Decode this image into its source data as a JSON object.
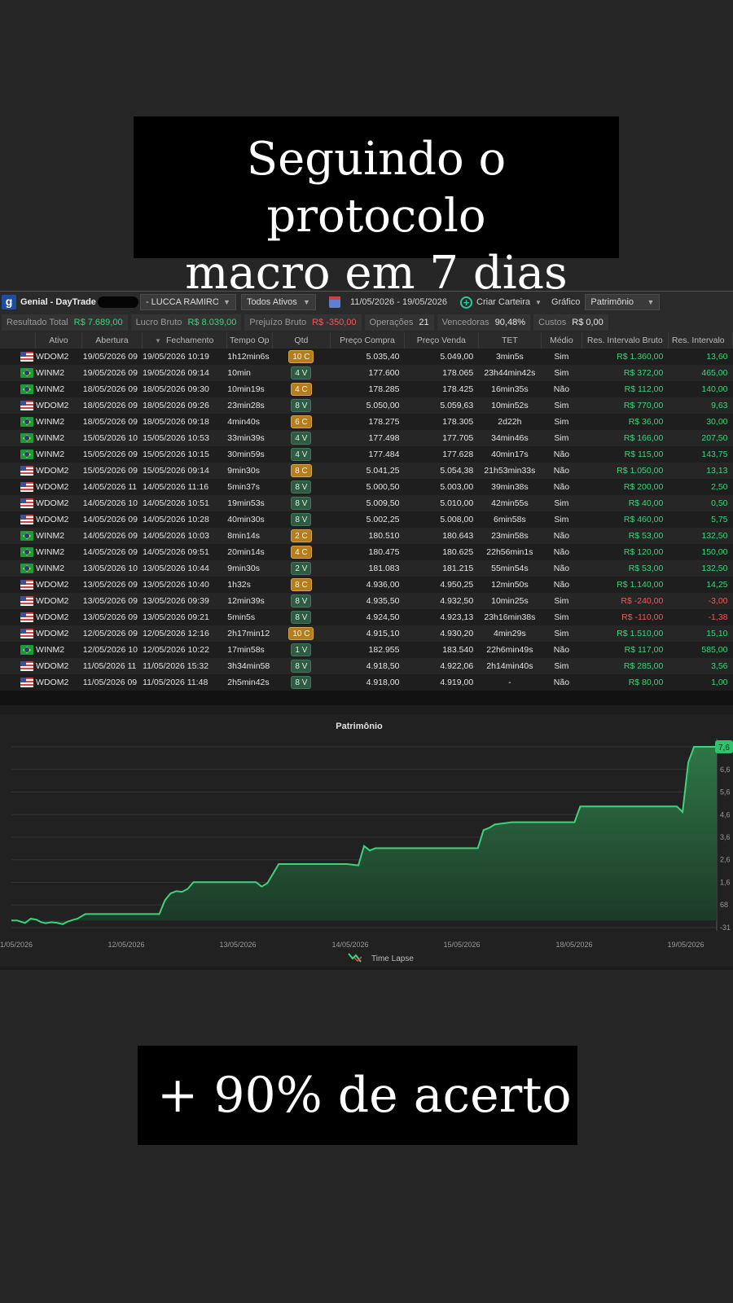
{
  "captions": {
    "top_line1": "Seguindo o protocolo",
    "top_line2": "macro em 7 dias",
    "bottom": "+ 90% de acerto"
  },
  "toolbar": {
    "logo": "g",
    "account_prefix": "Genial - DayTrade",
    "account_name": "- LUCCA RAMIRO DE S",
    "asset_filter": "Todos Ativos",
    "date_range": "11/05/2026 - 19/05/2026",
    "create_wallet": "Criar Carteira",
    "chart_label": "Gráfico",
    "chart_select": "Patrimônio"
  },
  "stats": [
    {
      "label": "Resultado Total",
      "value": "R$ 7.689,00",
      "tone": "pos"
    },
    {
      "label": "Lucro Bruto",
      "value": "R$ 8.039,00",
      "tone": "pos"
    },
    {
      "label": "Prejuízo Bruto",
      "value": "R$ -350,00",
      "tone": "neg"
    },
    {
      "label": "Operações",
      "value": "21",
      "tone": "wht"
    },
    {
      "label": "Vencedoras",
      "value": "90,48%",
      "tone": "wht"
    },
    {
      "label": "Custos",
      "value": "R$ 0,00",
      "tone": "wht"
    }
  ],
  "table": {
    "headers": [
      "Ativo",
      "Abertura",
      "Fechamento",
      "Tempo Op",
      "Qtd",
      "Preço Compra",
      "Preço Venda",
      "TET",
      "Médio",
      "Res. Intervalo Bruto",
      "Res. Intervalo"
    ],
    "rows": [
      {
        "flag": "us",
        "ativo": "WDOM2",
        "abertura": "19/05/2026 09",
        "fechamento": "19/05/2026 10:19",
        "tempo": "1h12min6s",
        "qtd": "10 C",
        "side": "c",
        "compra": "5.035,40",
        "venda": "5.049,00",
        "tet": "3min5s",
        "medio": "Sim",
        "bruto": "R$ 1.360,00",
        "intervalo": "13,60",
        "tone": "pos"
      },
      {
        "flag": "br",
        "ativo": "WINM2",
        "abertura": "19/05/2026 09",
        "fechamento": "19/05/2026 09:14",
        "tempo": "10min",
        "qtd": "4 V",
        "side": "v",
        "compra": "177.600",
        "venda": "178.065",
        "tet": "23h44min42s",
        "medio": "Sim",
        "bruto": "R$ 372,00",
        "intervalo": "465,00",
        "tone": "pos"
      },
      {
        "flag": "br",
        "ativo": "WINM2",
        "abertura": "18/05/2026 09",
        "fechamento": "18/05/2026 09:30",
        "tempo": "10min19s",
        "qtd": "4 C",
        "side": "c",
        "compra": "178.285",
        "venda": "178.425",
        "tet": "16min35s",
        "medio": "Não",
        "bruto": "R$ 112,00",
        "intervalo": "140,00",
        "tone": "pos"
      },
      {
        "flag": "us",
        "ativo": "WDOM2",
        "abertura": "18/05/2026 09",
        "fechamento": "18/05/2026 09:26",
        "tempo": "23min28s",
        "qtd": "8 V",
        "side": "v",
        "compra": "5.050,00",
        "venda": "5.059,63",
        "tet": "10min52s",
        "medio": "Sim",
        "bruto": "R$ 770,00",
        "intervalo": "9,63",
        "tone": "pos"
      },
      {
        "flag": "br",
        "ativo": "WINM2",
        "abertura": "18/05/2026 09",
        "fechamento": "18/05/2026 09:18",
        "tempo": "4min40s",
        "qtd": "6 C",
        "side": "c",
        "compra": "178.275",
        "venda": "178.305",
        "tet": "2d22h",
        "medio": "Sim",
        "bruto": "R$ 36,00",
        "intervalo": "30,00",
        "tone": "pos"
      },
      {
        "flag": "br",
        "ativo": "WINM2",
        "abertura": "15/05/2026 10",
        "fechamento": "15/05/2026 10:53",
        "tempo": "33min39s",
        "qtd": "4 V",
        "side": "v",
        "compra": "177.498",
        "venda": "177.705",
        "tet": "34min46s",
        "medio": "Sim",
        "bruto": "R$ 166,00",
        "intervalo": "207,50",
        "tone": "pos"
      },
      {
        "flag": "br",
        "ativo": "WINM2",
        "abertura": "15/05/2026 09",
        "fechamento": "15/05/2026 10:15",
        "tempo": "30min59s",
        "qtd": "4 V",
        "side": "v",
        "compra": "177.484",
        "venda": "177.628",
        "tet": "40min17s",
        "medio": "Não",
        "bruto": "R$ 115,00",
        "intervalo": "143,75",
        "tone": "pos"
      },
      {
        "flag": "us",
        "ativo": "WDOM2",
        "abertura": "15/05/2026 09",
        "fechamento": "15/05/2026 09:14",
        "tempo": "9min30s",
        "qtd": "8 C",
        "side": "c",
        "compra": "5.041,25",
        "venda": "5.054,38",
        "tet": "21h53min33s",
        "medio": "Não",
        "bruto": "R$ 1.050,00",
        "intervalo": "13,13",
        "tone": "pos"
      },
      {
        "flag": "us",
        "ativo": "WDOM2",
        "abertura": "14/05/2026 11",
        "fechamento": "14/05/2026 11:16",
        "tempo": "5min37s",
        "qtd": "8 V",
        "side": "v",
        "compra": "5.000,50",
        "venda": "5.003,00",
        "tet": "39min38s",
        "medio": "Não",
        "bruto": "R$ 200,00",
        "intervalo": "2,50",
        "tone": "pos"
      },
      {
        "flag": "us",
        "ativo": "WDOM2",
        "abertura": "14/05/2026 10",
        "fechamento": "14/05/2026 10:51",
        "tempo": "19min53s",
        "qtd": "8 V",
        "side": "v",
        "compra": "5.009,50",
        "venda": "5.010,00",
        "tet": "42min55s",
        "medio": "Sim",
        "bruto": "R$ 40,00",
        "intervalo": "0,50",
        "tone": "pos"
      },
      {
        "flag": "us",
        "ativo": "WDOM2",
        "abertura": "14/05/2026 09",
        "fechamento": "14/05/2026 10:28",
        "tempo": "40min30s",
        "qtd": "8 V",
        "side": "v",
        "compra": "5.002,25",
        "venda": "5.008,00",
        "tet": "6min58s",
        "medio": "Sim",
        "bruto": "R$ 460,00",
        "intervalo": "5,75",
        "tone": "pos"
      },
      {
        "flag": "br",
        "ativo": "WINM2",
        "abertura": "14/05/2026 09",
        "fechamento": "14/05/2026 10:03",
        "tempo": "8min14s",
        "qtd": "2 C",
        "side": "c",
        "compra": "180.510",
        "venda": "180.643",
        "tet": "23min58s",
        "medio": "Não",
        "bruto": "R$ 53,00",
        "intervalo": "132,50",
        "tone": "pos"
      },
      {
        "flag": "br",
        "ativo": "WINM2",
        "abertura": "14/05/2026 09",
        "fechamento": "14/05/2026 09:51",
        "tempo": "20min14s",
        "qtd": "4 C",
        "side": "c",
        "compra": "180.475",
        "venda": "180.625",
        "tet": "22h56min1s",
        "medio": "Não",
        "bruto": "R$ 120,00",
        "intervalo": "150,00",
        "tone": "pos"
      },
      {
        "flag": "br",
        "ativo": "WINM2",
        "abertura": "13/05/2026 10",
        "fechamento": "13/05/2026 10:44",
        "tempo": "9min30s",
        "qtd": "2 V",
        "side": "v",
        "compra": "181.083",
        "venda": "181.215",
        "tet": "55min54s",
        "medio": "Não",
        "bruto": "R$ 53,00",
        "intervalo": "132,50",
        "tone": "pos"
      },
      {
        "flag": "us",
        "ativo": "WDOM2",
        "abertura": "13/05/2026 09",
        "fechamento": "13/05/2026 10:40",
        "tempo": "1h32s",
        "qtd": "8 C",
        "side": "c",
        "compra": "4.936,00",
        "venda": "4.950,25",
        "tet": "12min50s",
        "medio": "Não",
        "bruto": "R$ 1.140,00",
        "intervalo": "14,25",
        "tone": "pos"
      },
      {
        "flag": "us",
        "ativo": "WDOM2",
        "abertura": "13/05/2026 09",
        "fechamento": "13/05/2026 09:39",
        "tempo": "12min39s",
        "qtd": "8 V",
        "side": "v",
        "compra": "4.935,50",
        "venda": "4.932,50",
        "tet": "10min25s",
        "medio": "Sim",
        "bruto": "R$ -240,00",
        "intervalo": "-3,00",
        "tone": "neg"
      },
      {
        "flag": "us",
        "ativo": "WDOM2",
        "abertura": "13/05/2026 09",
        "fechamento": "13/05/2026 09:21",
        "tempo": "5min5s",
        "qtd": "8 V",
        "side": "v",
        "compra": "4.924,50",
        "venda": "4.923,13",
        "tet": "23h16min38s",
        "medio": "Sim",
        "bruto": "R$ -110,00",
        "intervalo": "-1,38",
        "tone": "neg"
      },
      {
        "flag": "us",
        "ativo": "WDOM2",
        "abertura": "12/05/2026 09",
        "fechamento": "12/05/2026 12:16",
        "tempo": "2h17min12",
        "qtd": "10 C",
        "side": "c",
        "compra": "4.915,10",
        "venda": "4.930,20",
        "tet": "4min29s",
        "medio": "Sim",
        "bruto": "R$ 1.510,00",
        "intervalo": "15,10",
        "tone": "pos"
      },
      {
        "flag": "br",
        "ativo": "WINM2",
        "abertura": "12/05/2026 10",
        "fechamento": "12/05/2026 10:22",
        "tempo": "17min58s",
        "qtd": "1 V",
        "side": "v",
        "compra": "182.955",
        "venda": "183.540",
        "tet": "22h6min49s",
        "medio": "Não",
        "bruto": "R$ 117,00",
        "intervalo": "585,00",
        "tone": "pos"
      },
      {
        "flag": "us",
        "ativo": "WDOM2",
        "abertura": "11/05/2026 11",
        "fechamento": "11/05/2026 15:32",
        "tempo": "3h34min58",
        "qtd": "8 V",
        "side": "v",
        "compra": "4.918,50",
        "venda": "4.922,06",
        "tet": "2h14min40s",
        "medio": "Sim",
        "bruto": "R$ 285,00",
        "intervalo": "3,56",
        "tone": "pos"
      },
      {
        "flag": "us",
        "ativo": "WDOM2",
        "abertura": "11/05/2026 09",
        "fechamento": "11/05/2026 11:48",
        "tempo": "2h5min42s",
        "qtd": "8 V",
        "side": "v",
        "compra": "4.918,00",
        "venda": "4.919,00",
        "tet": "-",
        "medio": "Não",
        "bruto": "R$ 80,00",
        "intervalo": "1,00",
        "tone": "pos"
      }
    ]
  },
  "chart_data": {
    "type": "area",
    "title": "Patrimônio",
    "legend": "Time Lapse",
    "legend_position": "bottom-center",
    "grid": true,
    "x_ticks": [
      "1/05/2026",
      "12/05/2026",
      "13/05/2026",
      "14/05/2026",
      "15/05/2026",
      "18/05/2026",
      "19/05/2026"
    ],
    "y_ticks": [
      "-31",
      "68",
      "1,6",
      "2,6",
      "3,6",
      "4,6",
      "5,6",
      "6,6",
      "7,6"
    ],
    "y_tick_values": [
      -313,
      688,
      1688,
      2688,
      3688,
      4688,
      5688,
      6688,
      7689
    ],
    "ylim": [
      -313,
      7689
    ],
    "x_range": [
      0,
      6.2
    ],
    "series": [
      {
        "color": "#3ed37a",
        "x": [
          0,
          0.05,
          0.12,
          0.17,
          0.22,
          0.26,
          0.3,
          0.35,
          0.4,
          0.45,
          0.5,
          0.55,
          0.58,
          0.65,
          0.72,
          0.8,
          0.85,
          0.9,
          1.0,
          1.1,
          1.2,
          1.3,
          1.35,
          1.4,
          1.45,
          1.5,
          1.55,
          1.6,
          1.7,
          1.8,
          1.9,
          2.0,
          2.05,
          2.1,
          2.15,
          2.2,
          2.25,
          2.35,
          2.5,
          2.7,
          2.95,
          3.05,
          3.1,
          3.15,
          3.2,
          3.3,
          3.5,
          3.7,
          3.95,
          4.0,
          4.05,
          4.1,
          4.15,
          4.2,
          4.25,
          4.4,
          4.6,
          4.85,
          4.9,
          4.95,
          5.0,
          5.2,
          5.5,
          5.8,
          5.85,
          5.9,
          5.95,
          6.0,
          6.1,
          6.2
        ],
        "y": [
          0,
          0,
          -110,
          80,
          40,
          -70,
          -120,
          -80,
          -100,
          -160,
          -40,
          40,
          80,
          285,
          285,
          285,
          285,
          285,
          285,
          285,
          285,
          285,
          900,
          1200,
          1300,
          1270,
          1400,
          1700,
          1700,
          1700,
          1700,
          1700,
          1700,
          1700,
          1700,
          1500,
          1650,
          2500,
          2500,
          2500,
          2500,
          2440,
          3300,
          3100,
          3200,
          3200,
          3200,
          3200,
          3200,
          3200,
          3200,
          3200,
          4000,
          4100,
          4250,
          4350,
          4350,
          4350,
          4350,
          4350,
          5050,
          5050,
          5050,
          5050,
          5050,
          4800,
          7000,
          7689,
          7689,
          7689
        ]
      }
    ],
    "last_value_label": "7,6"
  }
}
